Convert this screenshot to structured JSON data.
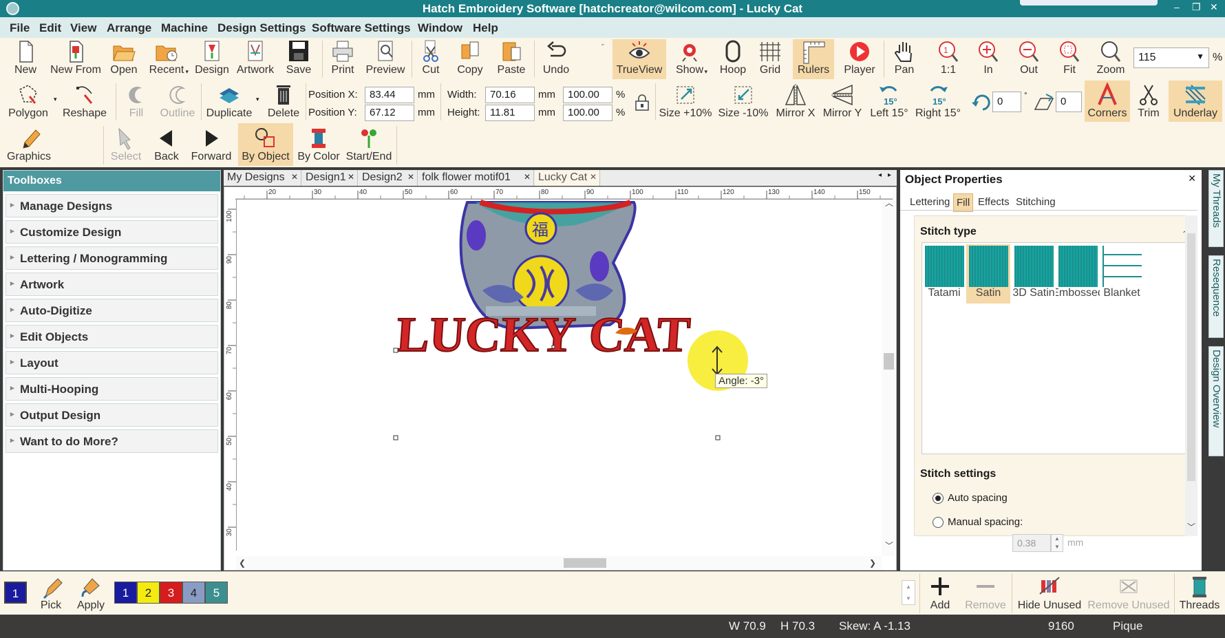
{
  "titlebar": {
    "title": "Hatch Embroidery Software [hatchcreator@wilcom.com] - Lucky Cat",
    "min": "–",
    "restore": "❐",
    "close": "✕"
  },
  "menu": [
    "File",
    "Edit",
    "View",
    "Arrange",
    "Machine",
    "Design Settings",
    "Software Settings",
    "Window",
    "Help"
  ],
  "toolbar1": {
    "new": "New",
    "new_from": "New From",
    "open": "Open",
    "recent": "Recent",
    "design": "Design",
    "artwork": "Artwork",
    "save": "Save",
    "print": "Print",
    "preview": "Preview",
    "cut": "Cut",
    "copy": "Copy",
    "paste": "Paste",
    "undo": "Undo",
    "trueview": "TrueView",
    "show": "Show",
    "hoop": "Hoop",
    "grid": "Grid",
    "rulers": "Rulers",
    "player": "Player",
    "pan": "Pan",
    "one_to_one": "1:1",
    "zoom_in": "In",
    "zoom_out": "Out",
    "fit": "Fit",
    "zoom": "Zoom",
    "zoom_value": "115",
    "zoom_unit": "%"
  },
  "toolbar2": {
    "polygon": "Polygon",
    "reshape": "Reshape",
    "fill": "Fill",
    "outline": "Outline",
    "duplicate": "Duplicate",
    "delete": "Delete",
    "pos_x_label": "Position X:",
    "pos_x": "83.44",
    "pos_y_label": "Position Y:",
    "pos_y": "67.12",
    "width_label": "Width:",
    "width": "70.16",
    "height_label": "Height:",
    "height": "11.81",
    "unit_mm": "mm",
    "scale_w": "100.00",
    "scale_h": "100.00",
    "pct": "%",
    "size_up": "Size +10%",
    "size_down": "Size -10%",
    "mirror_x": "Mirror X",
    "mirror_y": "Mirror Y",
    "left15": "Left 15°",
    "right15": "Right 15°",
    "rot_angle": "0",
    "skew_angle": "0",
    "deg": "°",
    "corners": "Corners",
    "trim": "Trim",
    "underlay": "Underlay",
    "badge15": "15°"
  },
  "toolbar3": {
    "graphics": "Graphics",
    "select": "Select",
    "back": "Back",
    "forward": "Forward",
    "by_object": "By Object",
    "by_color": "By Color",
    "start_end": "Start/End"
  },
  "toolboxes": {
    "header": "Toolboxes",
    "items": [
      "Manage Designs",
      "Customize Design",
      "Lettering / Monogramming",
      "Artwork",
      "Auto-Digitize",
      "Edit Objects",
      "Layout",
      "Multi-Hooping",
      "Output Design",
      "Want to do More?"
    ]
  },
  "tabs": [
    "My Designs",
    "Design1",
    "Design2",
    "folk flower motif01",
    "Lucky Cat"
  ],
  "ruler_h": [
    "20",
    "30",
    "40",
    "50",
    "60",
    "70",
    "80",
    "90",
    "100",
    "110",
    "120",
    "130",
    "140",
    "150"
  ],
  "ruler_v": [
    "100",
    "90",
    "80",
    "70",
    "60",
    "50",
    "40",
    "30"
  ],
  "canvas": {
    "lettering1": "LUCKY",
    "lettering2": "CAT",
    "tooltip": "Angle: -3°",
    "cat_char": "福"
  },
  "props": {
    "title": "Object Properties",
    "tabs": [
      "Lettering",
      "Fill",
      "Effects",
      "Stitching"
    ],
    "stitch_type_label": "Stitch type",
    "stitch_types": [
      "Tatami",
      "Satin",
      "3D Satin",
      "Embossed",
      "Blanket"
    ],
    "stitch_settings_label": "Stitch settings",
    "auto_spacing": "Auto spacing",
    "manual_spacing": "Manual spacing:",
    "spacing_value": "0.38",
    "spacing_unit": "mm"
  },
  "side_tabs": [
    "My Threads",
    "Resequence",
    "Design Overview"
  ],
  "bottom": {
    "chip_current": "1",
    "pick": "Pick",
    "apply": "Apply",
    "colors": [
      {
        "n": "1",
        "bg": "#1a1a9e",
        "fg": "#ffffff"
      },
      {
        "n": "2",
        "bg": "#f5ea10",
        "fg": "#222222"
      },
      {
        "n": "3",
        "bg": "#d61c1c",
        "fg": "#ffffff"
      },
      {
        "n": "4",
        "bg": "#8a9cc4",
        "fg": "#222222"
      },
      {
        "n": "5",
        "bg": "#3d8f8f",
        "fg": "#ffffff"
      }
    ],
    "add": "Add",
    "remove": "Remove",
    "hide_unused": "Hide Unused",
    "remove_unused": "Remove Unused",
    "threads": "Threads"
  },
  "status": {
    "w": "W  70.9",
    "h": "H  70.3",
    "skew": "Skew: A  -1.13",
    "stitches": "9160",
    "fabric": "Pique"
  }
}
